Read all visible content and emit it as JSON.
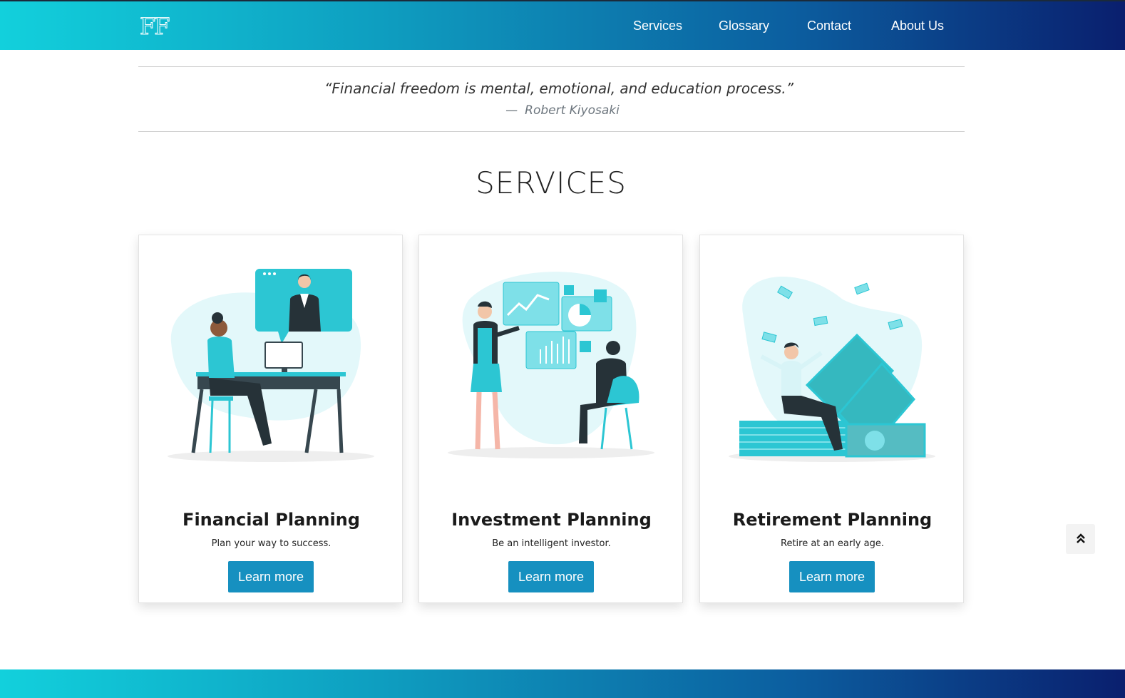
{
  "header": {
    "logo_text": "FF",
    "nav": [
      {
        "label": "Services"
      },
      {
        "label": "Glossary"
      },
      {
        "label": "Contact"
      },
      {
        "label": "About Us"
      }
    ]
  },
  "quote": {
    "text": "“Financial freedom is mental, emotional, and education process.”",
    "dash": "—",
    "author": "Robert Kiyosaki"
  },
  "services": {
    "title": "SERVICES",
    "cards": [
      {
        "title": "Financial Planning",
        "text": "Plan your way to success.",
        "button": "Learn more",
        "illustration": "person-video-call-illustration"
      },
      {
        "title": "Investment Planning",
        "text": "Be an intelligent investor.",
        "button": "Learn more",
        "illustration": "investors-charts-illustration"
      },
      {
        "title": "Retirement Planning",
        "text": "Retire at an early age.",
        "button": "Learn more",
        "illustration": "man-on-money-stack-illustration"
      }
    ]
  },
  "scroll_top": {
    "icon": "double-chevron-up-icon"
  },
  "colors": {
    "accent": "#1690c0",
    "teal": "#12d0dc",
    "navy": "#0a1f6e",
    "illustration_teal": "#2cc6d3"
  }
}
